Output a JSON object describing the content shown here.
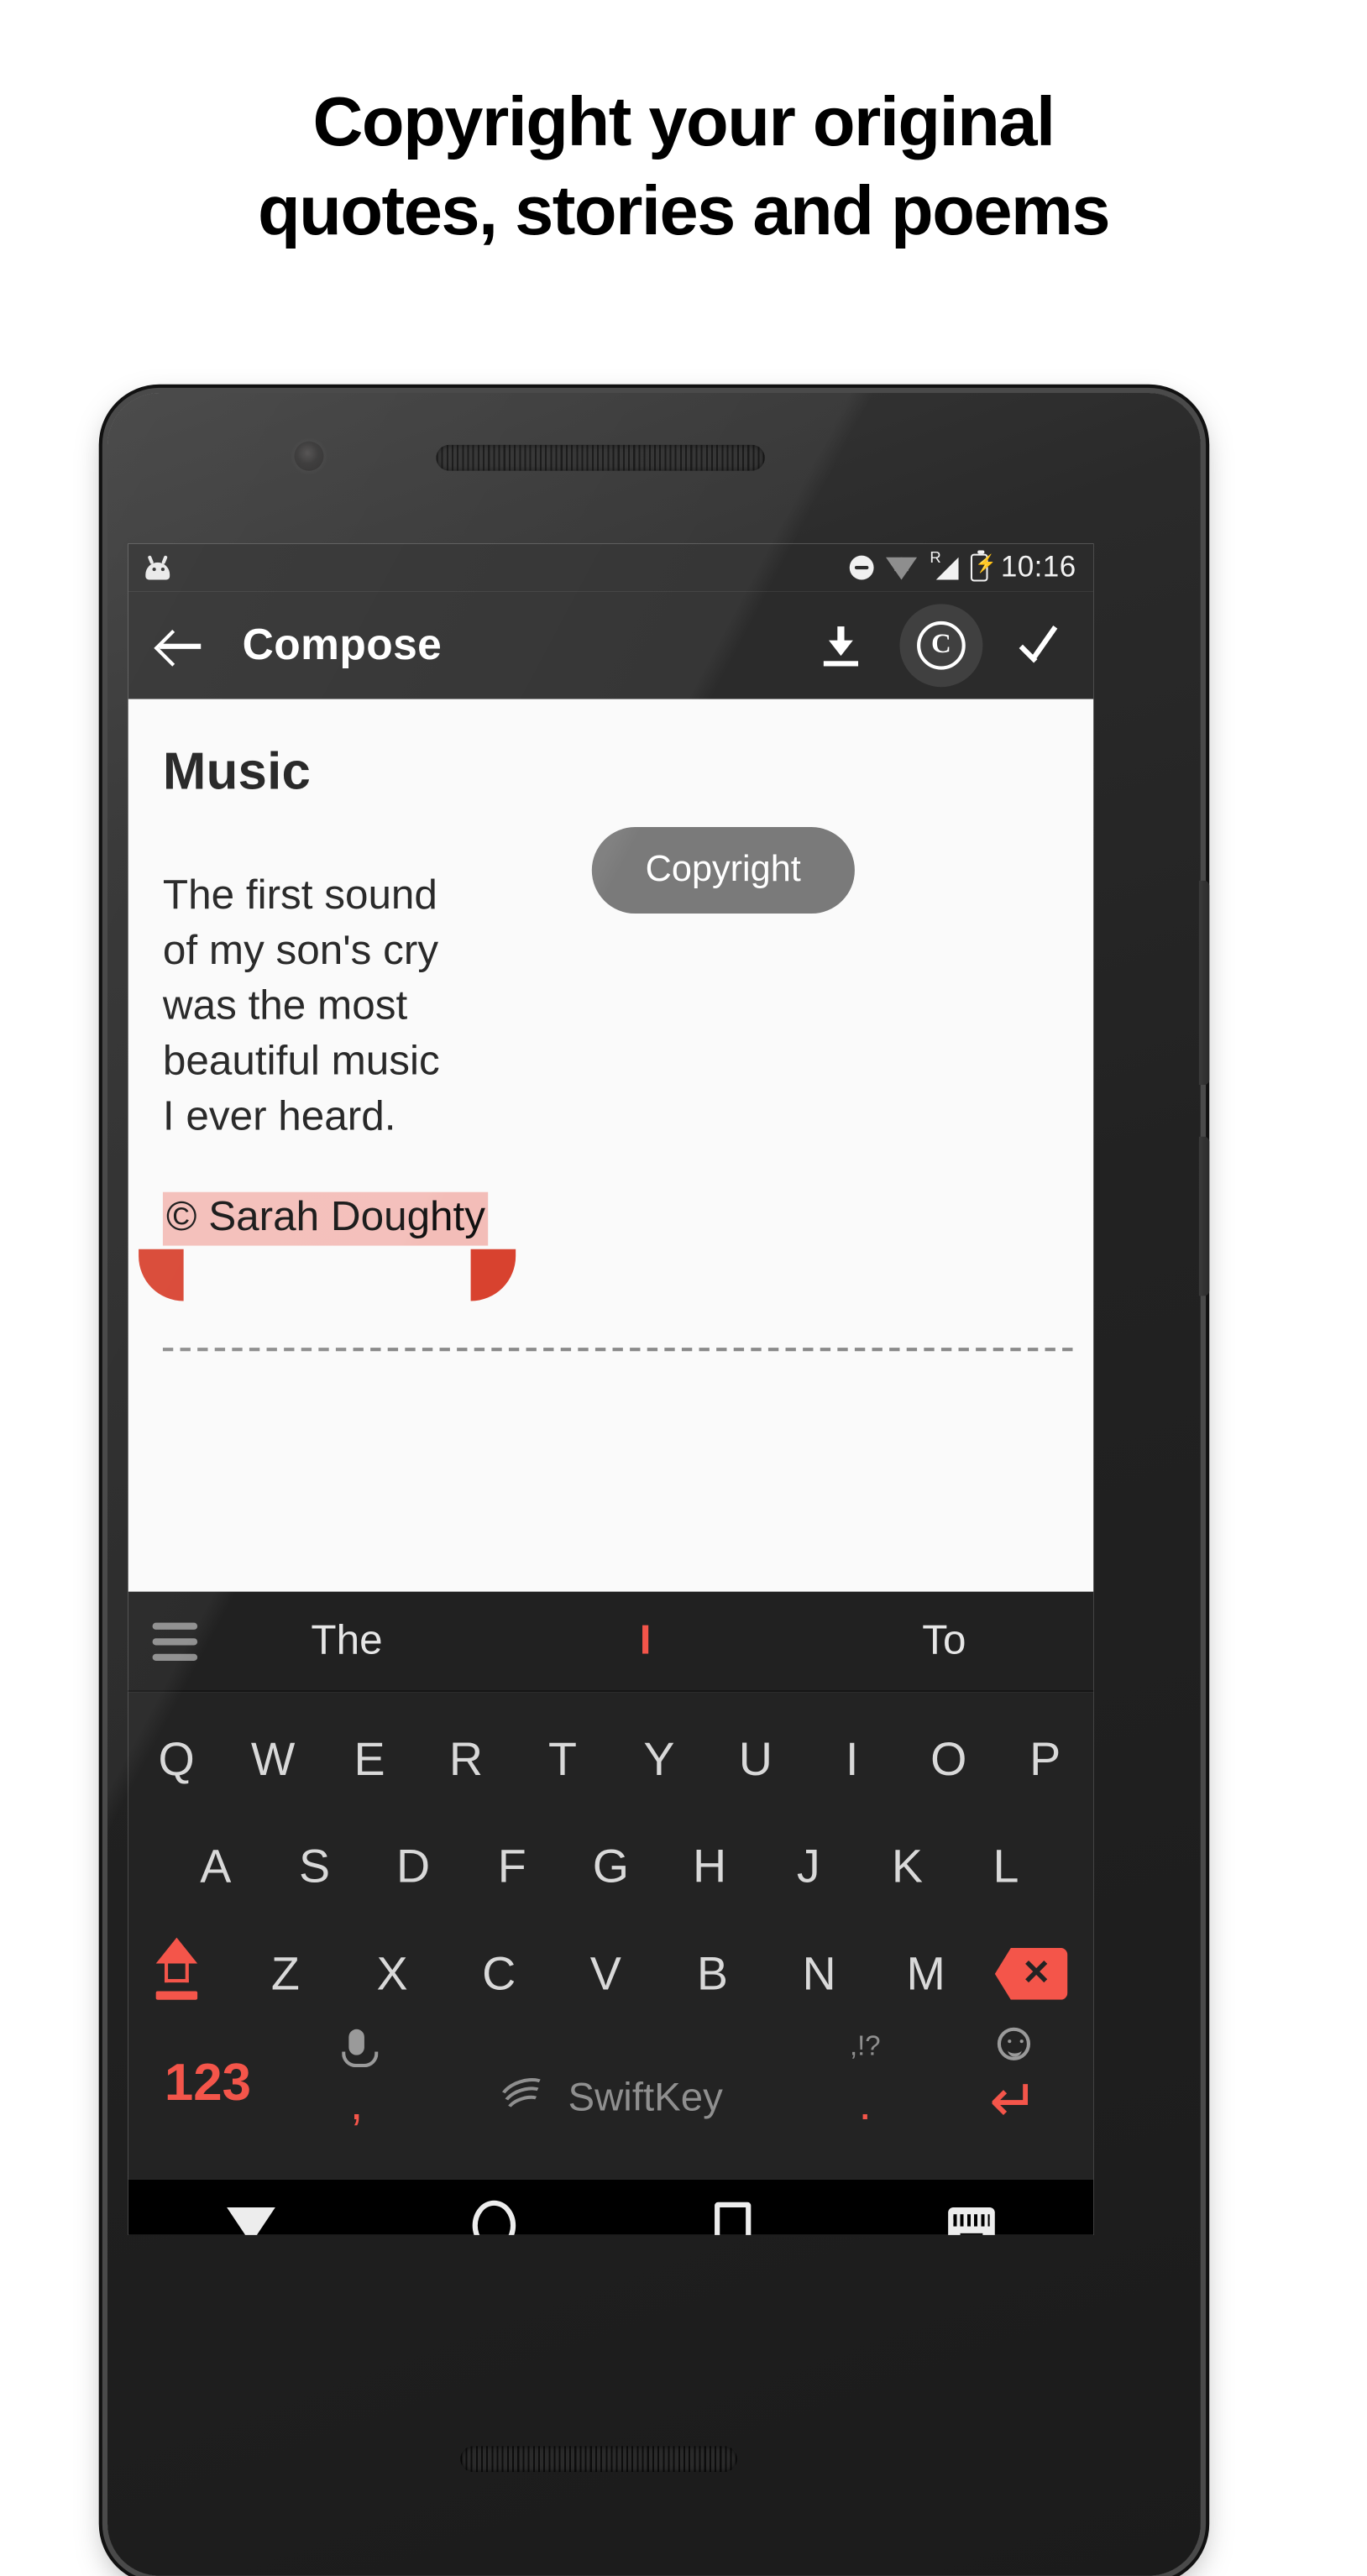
{
  "headline": {
    "line1": "Copyright your original",
    "line2": "quotes, stories and poems"
  },
  "statusbar": {
    "app_icon": "android-robot-icon",
    "dnd_icon": "do-not-disturb-icon",
    "wifi_icon": "wifi-icon",
    "roaming_label": "R",
    "signal_icon": "cellular-signal-icon",
    "battery_icon": "battery-charging-icon",
    "battery_bolt": "⚡",
    "time": "10:16"
  },
  "toolbar": {
    "back_icon": "arrow-back-icon",
    "title": "Compose",
    "download_icon": "download-icon",
    "copyright_icon": "copyright-icon",
    "copyright_glyph": "C",
    "confirm_icon": "check-icon"
  },
  "tooltip": {
    "label": "Copyright"
  },
  "note": {
    "title": "Music",
    "body": "The first sound\nof my son's cry\nwas the most\nbeautiful music\nI ever heard.",
    "signature": "© Sarah Doughty",
    "selection_highlight_color": "#f3bdb8",
    "selection_handle_color": "#d8422f"
  },
  "keyboard": {
    "menu_icon": "hamburger-menu-icon",
    "predictions": [
      "The",
      "I",
      "To"
    ],
    "accent_color": "#f4554a",
    "row1": [
      "Q",
      "W",
      "E",
      "R",
      "T",
      "Y",
      "U",
      "I",
      "O",
      "P"
    ],
    "row2": [
      "A",
      "S",
      "D",
      "F",
      "G",
      "H",
      "J",
      "K",
      "L"
    ],
    "row3": [
      "Z",
      "X",
      "C",
      "V",
      "B",
      "N",
      "M"
    ],
    "shift_icon": "caps-lock-icon",
    "backspace_icon": "backspace-icon",
    "backspace_glyph": "✕",
    "numbers_label": "123",
    "mic_icon": "microphone-icon",
    "comma_label": ",",
    "brand": "SwiftKey",
    "brand_icon": "swiftkey-logo-icon",
    "punctuation_label": ",!?",
    "period_label": ".",
    "emoji_icon": "emoji-icon",
    "enter_icon": "enter-key-icon",
    "enter_glyph": "↵"
  },
  "navbar": {
    "back_icon": "hide-keyboard-down-icon",
    "home_icon": "home-circle-icon",
    "recents_icon": "recents-square-icon",
    "keyboard_icon": "keyboard-switch-icon"
  }
}
